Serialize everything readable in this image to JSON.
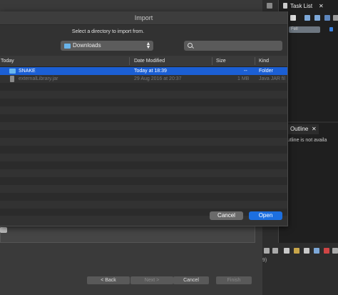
{
  "dialog": {
    "title": "Import",
    "prompt": "Select a directory to import from.",
    "location": "Downloads",
    "columns": {
      "name": "Today",
      "date": "Date Modified",
      "size": "Size",
      "kind": "Kind"
    },
    "rows": [
      {
        "name": "SNAKE",
        "date": "Today at 18:39",
        "size": "--",
        "kind": "Folder",
        "selected": true
      },
      {
        "name": "externalLibrary.jar",
        "date": "29 Aug 2016 at 20:37",
        "size": "1 MB",
        "kind": "Java JAR fil",
        "selected": false
      }
    ],
    "cancel_label": "Cancel",
    "open_label": "Open"
  },
  "wizard": {
    "back_label": "< Back",
    "next_label": "Next >",
    "cancel_label": "Cancel",
    "finish_label": "Finish"
  },
  "side": {
    "task_list_tab": "Task List",
    "task_list_close": "✕",
    "outline_tab": "Outline",
    "outline_close": "✕",
    "outline_msg": "n outline is not availa",
    "filter_text": "Fell",
    "bottom_text": "9)"
  }
}
